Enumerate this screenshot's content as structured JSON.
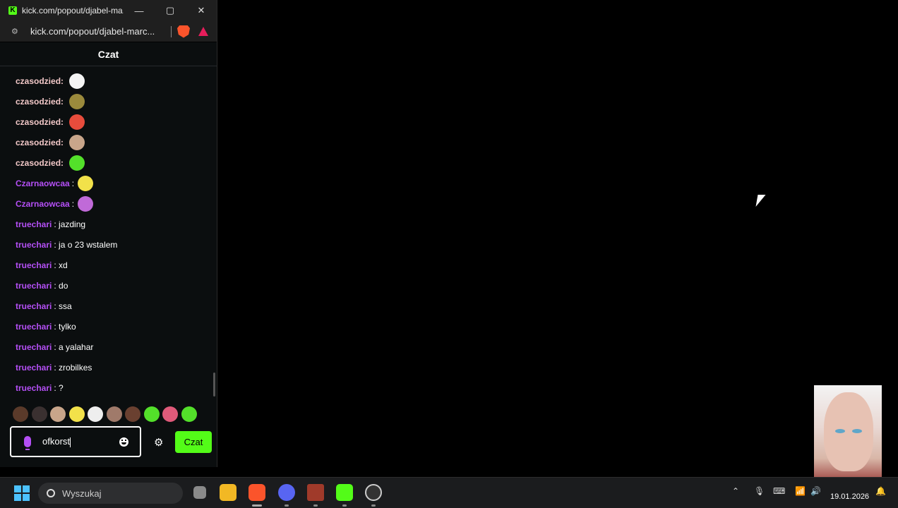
{
  "window": {
    "title": "kick.com/popout/djabel-ma...",
    "url": "kick.com/popout/djabel-marc...",
    "minimize": "—",
    "maximize": "▢",
    "close": "✕"
  },
  "chat": {
    "header": "Czat",
    "messages": [
      {
        "user": "czasodzied:",
        "text": "",
        "emote_color": "#f4f4f4",
        "user_color": "#f2c8c8"
      },
      {
        "user": "czasodzied:",
        "text": "",
        "emote_color": "#9b8a3c",
        "user_color": "#f2c8c8"
      },
      {
        "user": "czasodzied:",
        "text": "",
        "emote_color": "#e74c3c",
        "user_color": "#f2c8c8"
      },
      {
        "user": "czasodzied:",
        "text": "",
        "emote_color": "#c8a58a",
        "user_color": "#f2c8c8"
      },
      {
        "user": "czasodzied:",
        "text": "",
        "emote_color": "#53e02a",
        "user_color": "#f2c8c8"
      },
      {
        "user": "Czarnaowcaa",
        "text": ":",
        "emote_color": "#f2e14a",
        "user_color": "#b44ff5"
      },
      {
        "user": "Czarnaowcaa",
        "text": ":",
        "emote_color": "#c06ad8",
        "user_color": "#b44ff5"
      },
      {
        "user": "truechari",
        "text": ": jazding",
        "emote_color": "",
        "user_color": "#b44ff5"
      },
      {
        "user": "truechari",
        "text": ": ja o 23 wstalem",
        "emote_color": "",
        "user_color": "#b44ff5"
      },
      {
        "user": "truechari",
        "text": ": xd",
        "emote_color": "",
        "user_color": "#b44ff5"
      },
      {
        "user": "truechari",
        "text": ": do",
        "emote_color": "",
        "user_color": "#b44ff5"
      },
      {
        "user": "truechari",
        "text": ": ssa",
        "emote_color": "",
        "user_color": "#b44ff5"
      },
      {
        "user": "truechari",
        "text": ": tylko",
        "emote_color": "",
        "user_color": "#b44ff5"
      },
      {
        "user": "truechari",
        "text": ": a yalahar",
        "emote_color": "",
        "user_color": "#b44ff5"
      },
      {
        "user": "truechari",
        "text": ": zrobilkes",
        "emote_color": "",
        "user_color": "#b44ff5"
      },
      {
        "user": "truechari",
        "text": ": ?",
        "emote_color": "",
        "user_color": "#b44ff5"
      }
    ],
    "emote_bar": [
      "#5a3a2a",
      "#3a3030",
      "#c8a58a",
      "#f2e14a",
      "#eeeeee",
      "#a07a6a",
      "#6a4030",
      "#53e02a",
      "#e05a7a",
      "#53e02a"
    ],
    "input_value": "ofkorst",
    "send_label": "Czat"
  },
  "taskbar": {
    "search_label": "Wyszukaj",
    "clock_date": "19.01.2026"
  },
  "colors": {
    "accent": "#53fc18",
    "username_purple": "#b44ff5",
    "background": "#0b0e0f"
  }
}
